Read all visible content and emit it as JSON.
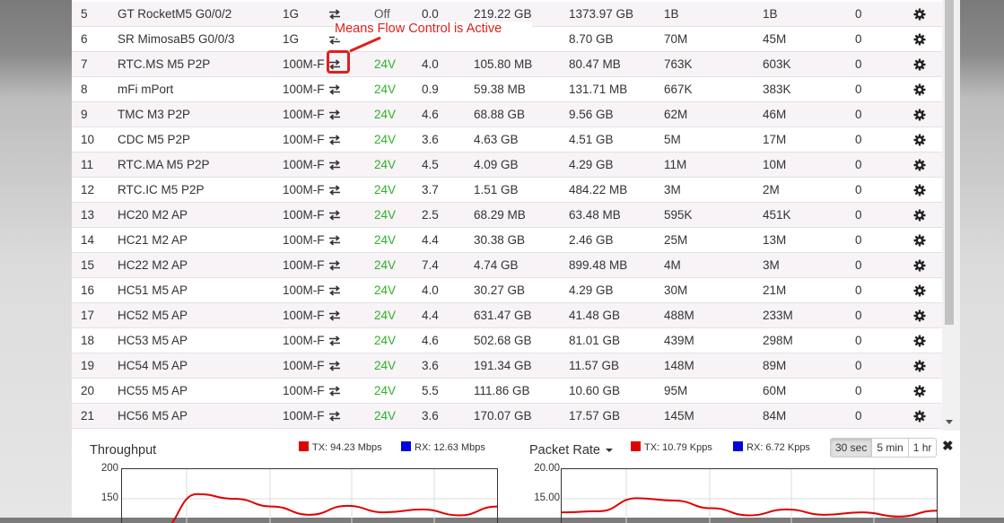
{
  "annotation": {
    "text": "Means Flow Control is Active",
    "color": "#e0201b"
  },
  "ports": [
    {
      "num": "5",
      "name": "GT RocketM5 G0/0/2",
      "speed": "1G",
      "flow_control": true,
      "poe": "Off",
      "watts": "0.0",
      "tx": "219.22 GB",
      "rx": "1373.97 GB",
      "tx_packets": "1B",
      "rx_packets": "1B",
      "errors": "0"
    },
    {
      "num": "6",
      "name": "SR MimosaB5 G0/0/3",
      "speed": "1G",
      "flow_control": true,
      "poe": "",
      "watts": "",
      "tx": "",
      "rx": "8.70 GB",
      "tx_packets": "70M",
      "rx_packets": "45M",
      "errors": "0"
    },
    {
      "num": "7",
      "name": "RTC.MS M5 P2P",
      "speed": "100M-F",
      "flow_control": true,
      "poe": "24V",
      "watts": "4.0",
      "tx": "105.80 MB",
      "rx": "80.47 MB",
      "tx_packets": "763K",
      "rx_packets": "603K",
      "errors": "0"
    },
    {
      "num": "8",
      "name": "mFi mPort",
      "speed": "100M-F",
      "flow_control": true,
      "poe": "24V",
      "watts": "0.9",
      "tx": "59.38 MB",
      "rx": "131.71 MB",
      "tx_packets": "667K",
      "rx_packets": "383K",
      "errors": "0"
    },
    {
      "num": "9",
      "name": "TMC M3 P2P",
      "speed": "100M-F",
      "flow_control": true,
      "poe": "24V",
      "watts": "4.6",
      "tx": "68.88 GB",
      "rx": "9.56 GB",
      "tx_packets": "62M",
      "rx_packets": "46M",
      "errors": "0"
    },
    {
      "num": "10",
      "name": "CDC M5 P2P",
      "speed": "100M-F",
      "flow_control": true,
      "poe": "24V",
      "watts": "3.6",
      "tx": "4.63 GB",
      "rx": "4.51 GB",
      "tx_packets": "5M",
      "rx_packets": "17M",
      "errors": "0"
    },
    {
      "num": "11",
      "name": "RTC.MA M5 P2P",
      "speed": "100M-F",
      "flow_control": true,
      "poe": "24V",
      "watts": "4.5",
      "tx": "4.09 GB",
      "rx": "4.29 GB",
      "tx_packets": "11M",
      "rx_packets": "10M",
      "errors": "0"
    },
    {
      "num": "12",
      "name": "RTC.IC M5 P2P",
      "speed": "100M-F",
      "flow_control": true,
      "poe": "24V",
      "watts": "3.7",
      "tx": "1.51 GB",
      "rx": "484.22 MB",
      "tx_packets": "3M",
      "rx_packets": "2M",
      "errors": "0"
    },
    {
      "num": "13",
      "name": "HC20 M2 AP",
      "speed": "100M-F",
      "flow_control": true,
      "poe": "24V",
      "watts": "2.5",
      "tx": "68.29 MB",
      "rx": "63.48 MB",
      "tx_packets": "595K",
      "rx_packets": "451K",
      "errors": "0"
    },
    {
      "num": "14",
      "name": "HC21 M2 AP",
      "speed": "100M-F",
      "flow_control": true,
      "poe": "24V",
      "watts": "4.4",
      "tx": "30.38 GB",
      "rx": "2.46 GB",
      "tx_packets": "25M",
      "rx_packets": "13M",
      "errors": "0"
    },
    {
      "num": "15",
      "name": "HC22 M2 AP",
      "speed": "100M-F",
      "flow_control": true,
      "poe": "24V",
      "watts": "7.4",
      "tx": "4.74 GB",
      "rx": "899.48 MB",
      "tx_packets": "4M",
      "rx_packets": "3M",
      "errors": "0"
    },
    {
      "num": "16",
      "name": "HC51 M5 AP",
      "speed": "100M-F",
      "flow_control": true,
      "poe": "24V",
      "watts": "4.0",
      "tx": "30.27 GB",
      "rx": "4.29 GB",
      "tx_packets": "30M",
      "rx_packets": "21M",
      "errors": "0"
    },
    {
      "num": "17",
      "name": "HC52 M5 AP",
      "speed": "100M-F",
      "flow_control": true,
      "poe": "24V",
      "watts": "4.4",
      "tx": "631.47 GB",
      "rx": "41.48 GB",
      "tx_packets": "488M",
      "rx_packets": "233M",
      "errors": "0"
    },
    {
      "num": "18",
      "name": "HC53 M5 AP",
      "speed": "100M-F",
      "flow_control": true,
      "poe": "24V",
      "watts": "4.6",
      "tx": "502.68 GB",
      "rx": "81.01 GB",
      "tx_packets": "439M",
      "rx_packets": "298M",
      "errors": "0"
    },
    {
      "num": "19",
      "name": "HC54 M5 AP",
      "speed": "100M-F",
      "flow_control": true,
      "poe": "24V",
      "watts": "3.6",
      "tx": "191.34 GB",
      "rx": "11.57 GB",
      "tx_packets": "148M",
      "rx_packets": "89M",
      "errors": "0"
    },
    {
      "num": "20",
      "name": "HC55 M5 AP",
      "speed": "100M-F",
      "flow_control": true,
      "poe": "24V",
      "watts": "5.5",
      "tx": "111.86 GB",
      "rx": "10.60 GB",
      "tx_packets": "95M",
      "rx_packets": "60M",
      "errors": "0"
    },
    {
      "num": "21",
      "name": "HC56 M5 AP",
      "speed": "100M-F",
      "flow_control": true,
      "poe": "24V",
      "watts": "3.6",
      "tx": "170.07 GB",
      "rx": "17.57 GB",
      "tx_packets": "145M",
      "rx_packets": "84M",
      "errors": "0"
    }
  ],
  "colors": {
    "poe_on": "#2cb229",
    "tx": "#e00000",
    "rx": "#0000e0",
    "row_alt": "#f7f3f6"
  },
  "throughput": {
    "title": "Throughput",
    "tx_legend": "TX: 94.23 Mbps",
    "rx_legend": "RX: 12.63 Mbps",
    "y_ticks": [
      "200",
      "150"
    ]
  },
  "packet_rate": {
    "title": "Packet Rate",
    "tx_legend": "TX: 10.79 Kpps",
    "rx_legend": "RX: 6.72 Kpps",
    "y_ticks": [
      "20.00",
      "15.00"
    ]
  },
  "time_range": {
    "options": [
      "30 sec",
      "5 min",
      "1 hr"
    ],
    "selected": "30 sec"
  },
  "icons": {
    "flow_control": "flow-control-icon",
    "settings": "gear-icon",
    "close": "close-icon"
  },
  "chart_data": [
    {
      "type": "line",
      "title": "Throughput",
      "ylim": [
        0,
        200
      ],
      "y_ticks": [
        200,
        150
      ],
      "series": [
        {
          "name": "TX: 94.23 Mbps",
          "color": "#e00000",
          "values": [
            95,
            96,
            158,
            150,
            137,
            123,
            138,
            127,
            132,
            122,
            137
          ]
        },
        {
          "name": "RX: 12.63 Mbps"
        }
      ]
    },
    {
      "type": "line",
      "title": "Packet Rate",
      "ylim": [
        0,
        20
      ],
      "y_ticks": [
        20.0,
        15.0
      ],
      "series": [
        {
          "name": "TX: 10.79 Kpps",
          "color": "#e00000",
          "values": [
            12.7,
            12.9,
            15.1,
            14.7,
            13.4,
            12.2,
            13.2,
            12.3,
            12.7,
            12.0,
            13.0
          ]
        },
        {
          "name": "RX: 6.72 Kpps"
        }
      ]
    }
  ]
}
